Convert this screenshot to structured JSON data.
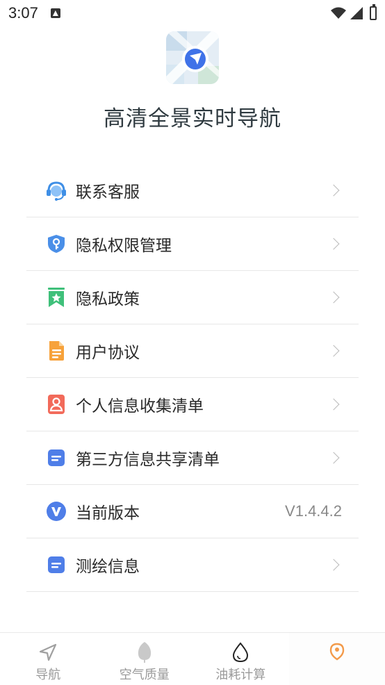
{
  "status_bar": {
    "time": "3:07"
  },
  "app": {
    "title": "高清全景实时导航"
  },
  "menu": {
    "items": [
      {
        "label": "联系客服",
        "icon": "customer-service-icon"
      },
      {
        "label": "隐私权限管理",
        "icon": "shield-key-icon"
      },
      {
        "label": "隐私政策",
        "icon": "bookmark-star-icon"
      },
      {
        "label": "用户协议",
        "icon": "document-icon"
      },
      {
        "label": "个人信息收集清单",
        "icon": "person-card-icon"
      },
      {
        "label": "第三方信息共享清单",
        "icon": "list-doc-icon"
      },
      {
        "label": "当前版本",
        "icon": "version-v-icon",
        "value": "V1.4.4.2"
      },
      {
        "label": "测绘信息",
        "icon": "list-doc-icon"
      }
    ]
  },
  "tabs": [
    {
      "label": "导航",
      "icon": "navigation-arrow-icon"
    },
    {
      "label": "空气质量",
      "icon": "leaf-icon"
    },
    {
      "label": "油耗计算",
      "icon": "drop-icon"
    },
    {
      "label": "",
      "icon": "pin-icon"
    }
  ],
  "colors": {
    "accent_blue": "#4a7ee6",
    "title_text": "#2f3a40",
    "divider": "#e7e7e7",
    "tab_text": "#9a9a9a"
  }
}
